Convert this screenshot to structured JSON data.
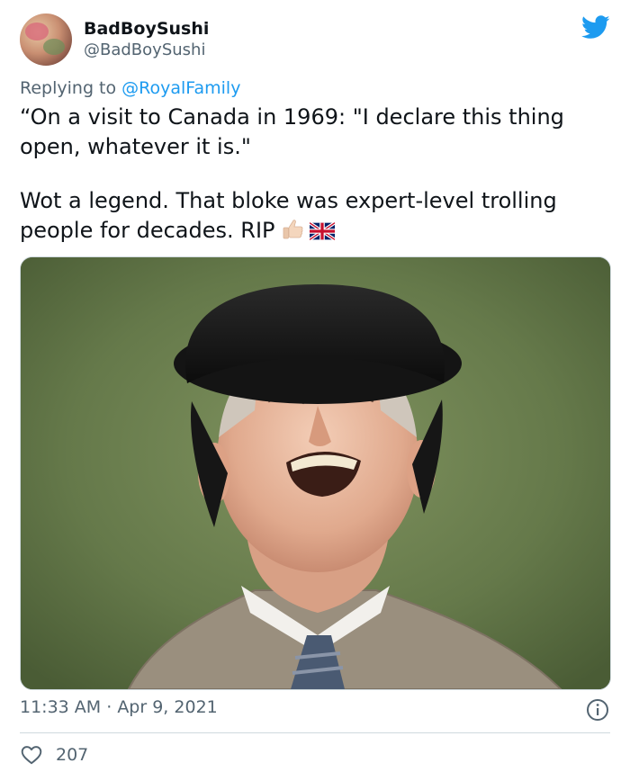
{
  "tweet": {
    "display_name": "BadBoySushi",
    "handle": "@BadBoySushi",
    "replying_prefix": "Replying to ",
    "replying_to": "@RoyalFamily",
    "paragraph1": "“On a visit to Canada in 1969: \"I declare this thing open, whatever it is.\"",
    "paragraph2": "Wot a legend. That bloke was expert-level trolling people for decades. RIP",
    "emojis": [
      "thumbs-up-icon",
      "uk-flag-icon"
    ],
    "time": "11:33 AM",
    "separator": " · ",
    "date": "Apr 9, 2021",
    "like_count": "207"
  },
  "icons": {
    "brand": "twitter-bird-icon",
    "info": "info-icon",
    "like": "heart-icon"
  },
  "colors": {
    "brand_blue": "#1d9bf0",
    "secondary_text": "#536471",
    "primary_text": "#0f1419",
    "border": "#cfd9de"
  }
}
